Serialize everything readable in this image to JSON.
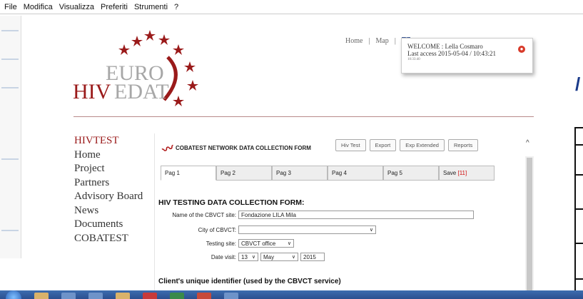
{
  "menubar": [
    "File",
    "Modifica",
    "Visualizza",
    "Preferiti",
    "Strumenti",
    "?"
  ],
  "logo": {
    "top": "EURO",
    "bottom_left": "HIV",
    "bottom_right": "EDAT"
  },
  "header_links": {
    "home": "Home",
    "sep1": "|",
    "map": "Map",
    "sep2": "|",
    "fb": "f"
  },
  "welcome": {
    "line1": "WELCOME : Lella Cosmaro",
    "line2": "Last access 2015-05-04 / 10:43:21",
    "line3": "10:33:40"
  },
  "nav": [
    "HIVTEST",
    "Home",
    "Project",
    "Partners",
    "Advisory Board",
    "News",
    "Documents",
    "COBATEST"
  ],
  "form_header": "COBATEST NETWORK DATA COLLECTION FORM",
  "top_buttons": [
    "Hiv Test",
    "Export",
    "Exp Extended",
    "Reports"
  ],
  "tabs": [
    {
      "label": "Pag 1"
    },
    {
      "label": "Pag 2"
    },
    {
      "label": "Pag 3"
    },
    {
      "label": "Pag 4"
    },
    {
      "label": "Pag 5"
    },
    {
      "label": "Save",
      "count": "[11]"
    }
  ],
  "form_title": "HIV TESTING DATA COLLECTION FORM:",
  "fields": {
    "site_label": "Name of the CBVCT site:",
    "site_value": "Fondazione LILA Mila",
    "city_label": "City of CBVCT:",
    "city_value": "",
    "testing_label": "Testing site:",
    "testing_value": "CBVCT office",
    "date_label": "Date visit:",
    "date_day": "13",
    "date_month": "May",
    "date_year": "2015"
  },
  "cid_title": "Client's unique identifier (used by the CBVCT service)",
  "colors": {
    "brand_red": "#9a1a1a",
    "fb_blue": "#3b5998"
  }
}
